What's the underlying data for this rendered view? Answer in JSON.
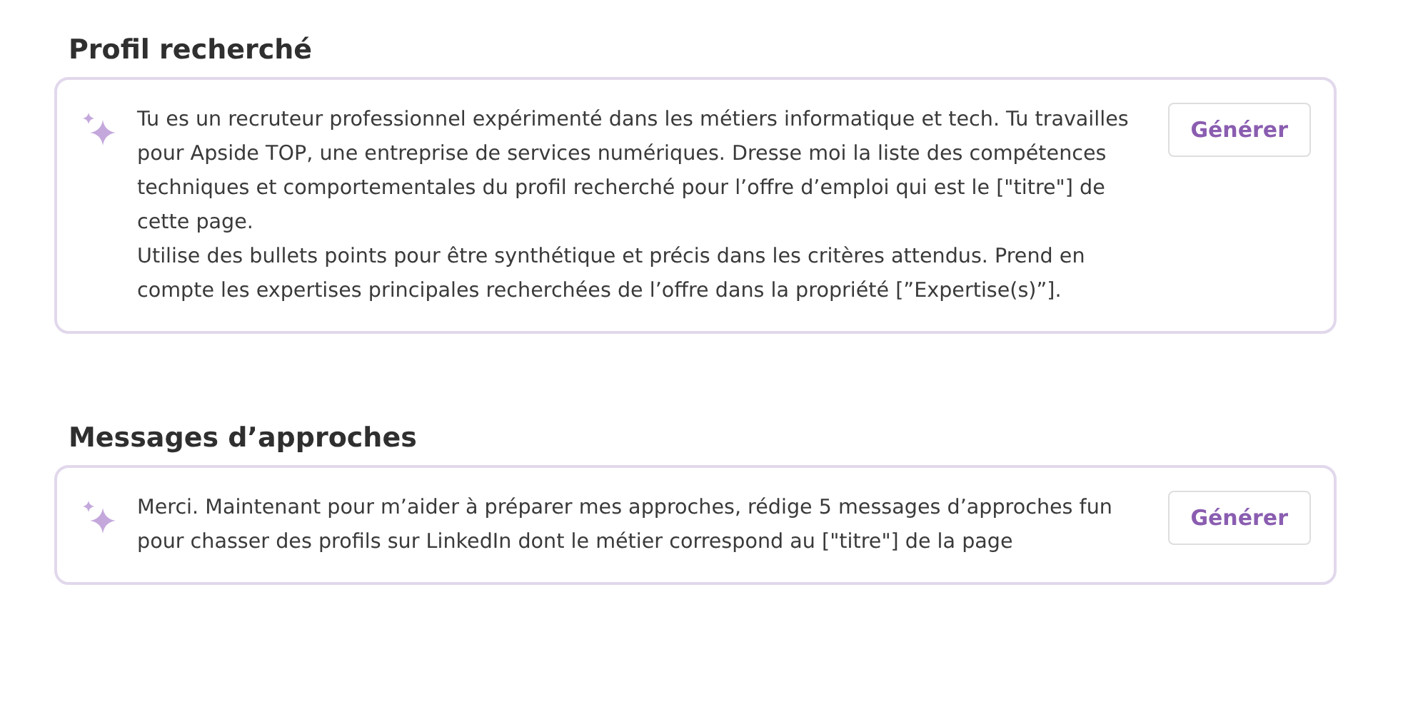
{
  "sections": [
    {
      "title": "Profil recherché",
      "paragraphs": [
        "Tu es un recruteur professionnel expérimenté dans les métiers informatique et tech. Tu travailles pour Apside TOP, une entreprise de services numériques. Dresse moi la liste des compétences techniques et comportementales du profil recherché pour l’offre d’emploi qui est le [\"titre\"] de cette page.",
        "Utilise des bullets points pour être synthétique et précis dans les critères attendus. Prend en compte les expertises principales recherchées de l’offre dans la propriété [”Expertise(s)”]."
      ],
      "button": "Générer"
    },
    {
      "title": "Messages d’approches",
      "paragraphs": [
        "Merci. Maintenant pour m’aider à préparer mes approches, rédige 5 messages d’approches fun pour chasser des profils sur LinkedIn dont le métier correspond au [\"titre\"] de la page"
      ],
      "button": "Générer"
    }
  ]
}
